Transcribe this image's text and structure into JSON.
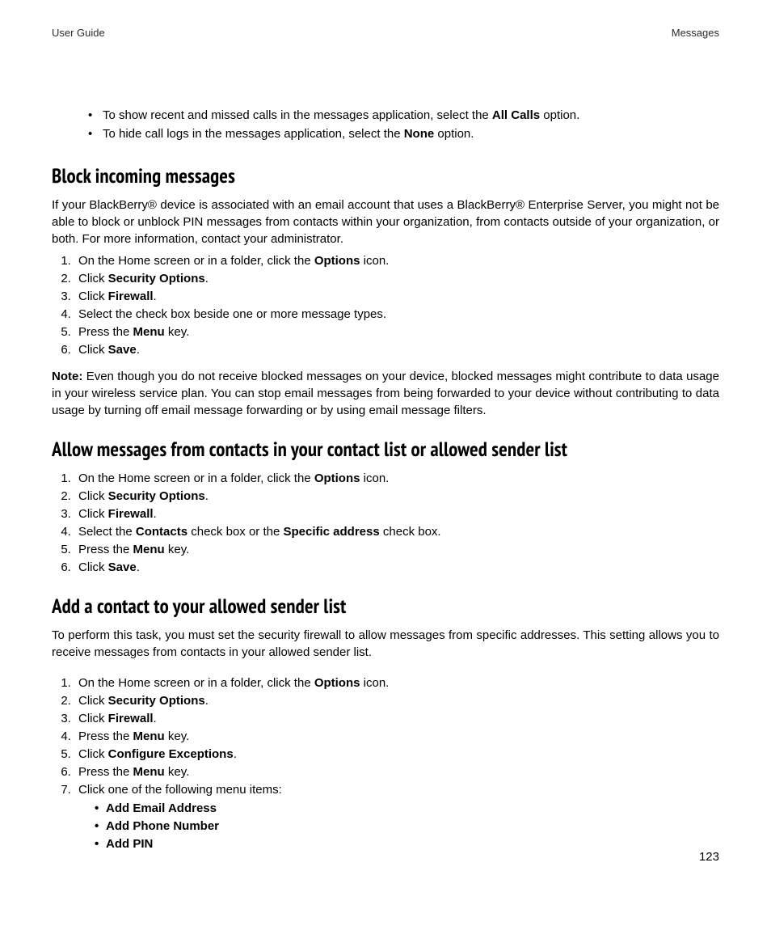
{
  "header": {
    "left": "User Guide",
    "right": "Messages"
  },
  "intro_bullets": [
    {
      "pre": "To show recent and missed calls in the messages application, select the ",
      "bold": "All Calls",
      "post": " option."
    },
    {
      "pre": "To hide call logs in the messages application, select the ",
      "bold": "None",
      "post": " option."
    }
  ],
  "sections": {
    "block": {
      "heading": "Block incoming messages",
      "para": "If your BlackBerry® device is associated with an email account that uses a BlackBerry® Enterprise Server, you might not be able to block or unblock PIN messages from contacts within your organization, from contacts outside of your organization, or both. For more information, contact your administrator.",
      "steps": [
        {
          "pre": "On the Home screen or in a folder, click the ",
          "bold": "Options",
          "post": " icon."
        },
        {
          "pre": "Click ",
          "bold": "Security Options",
          "post": "."
        },
        {
          "pre": "Click ",
          "bold": "Firewall",
          "post": "."
        },
        {
          "pre": "Select the check box beside one or more message types.",
          "bold": "",
          "post": ""
        },
        {
          "pre": "Press the ",
          "bold": "Menu",
          "post": " key."
        },
        {
          "pre": "Click ",
          "bold": "Save",
          "post": "."
        }
      ],
      "note_label": "Note:",
      "note_text": "  Even though you do not receive blocked messages on your device, blocked messages might contribute to data usage in your wireless service plan. You can stop email messages from being forwarded to your device without contributing to data usage by turning off email message forwarding or by using email message filters."
    },
    "allow": {
      "heading": "Allow messages from contacts in your contact list or allowed sender list",
      "steps": [
        {
          "pre": "On the Home screen or in a folder, click the ",
          "bold": "Options",
          "post": " icon."
        },
        {
          "pre": "Click ",
          "bold": "Security Options",
          "post": "."
        },
        {
          "pre": "Click ",
          "bold": "Firewall",
          "post": "."
        },
        {
          "pre": "Select the ",
          "bold": "Contacts",
          "mid": " check box or the ",
          "bold2": "Specific address",
          "post": " check box."
        },
        {
          "pre": "Press the ",
          "bold": "Menu",
          "post": " key."
        },
        {
          "pre": "Click ",
          "bold": "Save",
          "post": "."
        }
      ]
    },
    "add": {
      "heading": "Add a contact to your allowed sender list",
      "para": "To perform this task, you must set the security firewall to allow messages from specific addresses. This setting allows you to receive messages from contacts in your allowed sender list.",
      "steps": [
        {
          "pre": "On the Home screen or in a folder, click the ",
          "bold": "Options",
          "post": " icon."
        },
        {
          "pre": "Click ",
          "bold": "Security Options",
          "post": "."
        },
        {
          "pre": "Click ",
          "bold": "Firewall",
          "post": "."
        },
        {
          "pre": "Press the ",
          "bold": "Menu",
          "post": " key."
        },
        {
          "pre": "Click ",
          "bold": "Configure Exceptions",
          "post": "."
        },
        {
          "pre": "Press the ",
          "bold": "Menu",
          "post": " key."
        },
        {
          "pre": "Click one of the following menu items:",
          "bold": "",
          "post": ""
        }
      ],
      "subitems": [
        "Add Email Address",
        "Add Phone Number",
        "Add PIN"
      ]
    }
  },
  "page_number": "123"
}
